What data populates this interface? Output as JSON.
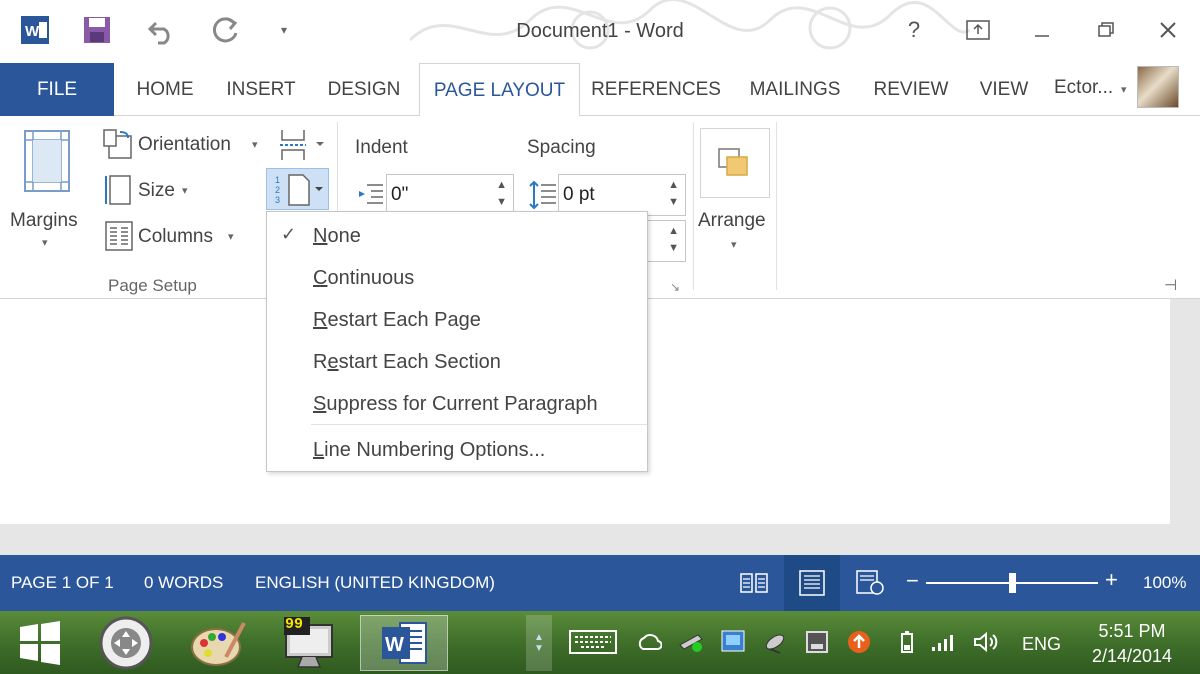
{
  "window": {
    "title": "Document1 - Word",
    "help": "?"
  },
  "tabs": {
    "file": "FILE",
    "home": "HOME",
    "insert": "INSERT",
    "design": "DESIGN",
    "page_layout": "PAGE LAYOUT",
    "references": "REFERENCES",
    "mailings": "MAILINGS",
    "review": "REVIEW",
    "view": "VIEW"
  },
  "user": {
    "name": "Ector..."
  },
  "ribbon": {
    "margins": "Margins",
    "orientation": "Orientation",
    "size": "Size",
    "columns": "Columns",
    "page_setup_group": "Page Setup",
    "indent_label": "Indent",
    "spacing_label": "Spacing",
    "indent_value": "0\"",
    "spacing_value": "0 pt",
    "arrange": "Arrange"
  },
  "line_numbers_menu": {
    "items": [
      {
        "pre": "",
        "key": "N",
        "post": "one",
        "checked": true
      },
      {
        "pre": "",
        "key": "C",
        "post": "ontinuous"
      },
      {
        "pre": "",
        "key": "R",
        "post": "estart Each Page"
      },
      {
        "pre": "R",
        "key": "e",
        "post": "start Each Section"
      },
      {
        "pre": "",
        "key": "S",
        "post": "uppress for Current Paragraph"
      },
      {
        "pre": "",
        "key": "L",
        "post": "ine Numbering Options..."
      }
    ]
  },
  "status": {
    "page": "PAGE 1 OF 1",
    "words": "0 WORDS",
    "language": "ENGLISH (UNITED KINGDOM)",
    "zoom": "100%"
  },
  "taskbar": {
    "badge": "99",
    "lang": "ENG",
    "time": "5:51 PM",
    "date": "2/14/2014"
  },
  "colors": {
    "accent": "#2b579a",
    "taskbar": "#3f6f2a"
  }
}
